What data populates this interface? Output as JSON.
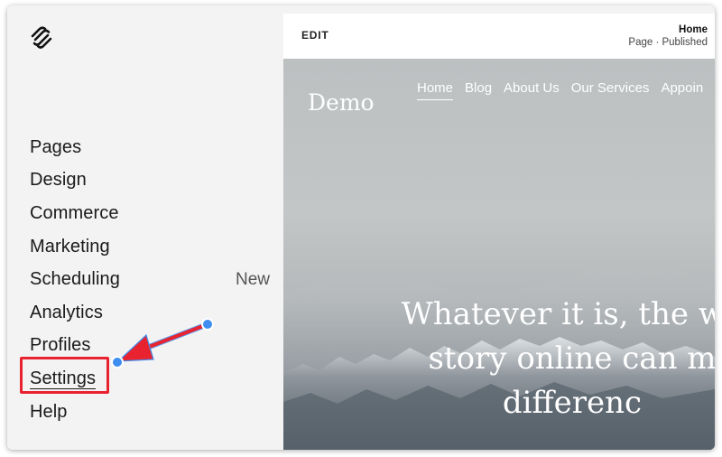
{
  "sidebar": {
    "logo_icon": "squarespace-logo-icon",
    "items": [
      {
        "label": "Pages",
        "badge": ""
      },
      {
        "label": "Design",
        "badge": ""
      },
      {
        "label": "Commerce",
        "badge": ""
      },
      {
        "label": "Marketing",
        "badge": ""
      },
      {
        "label": "Scheduling",
        "badge": "New"
      },
      {
        "label": "Analytics",
        "badge": ""
      },
      {
        "label": "Profiles",
        "badge": ""
      },
      {
        "label": "Settings",
        "badge": ""
      },
      {
        "label": "Help",
        "badge": ""
      }
    ]
  },
  "preview": {
    "edit_label": "EDIT",
    "page_title": "Home",
    "page_status": "Page · Published",
    "site_title": "Demo",
    "nav": [
      "Home",
      "Blog",
      "About Us",
      "Our Services",
      "Appoin"
    ],
    "headline": [
      "Whatever it is, the wa",
      "story online can m",
      "differenc"
    ]
  },
  "annotation": {
    "highlight_color": "#e8232f",
    "arrow_color": "#e8232f",
    "handle_color": "#3d8ef0"
  }
}
